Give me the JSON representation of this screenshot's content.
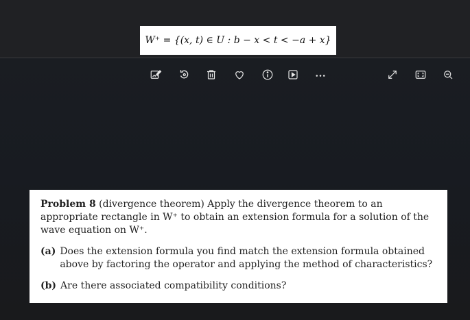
{
  "formula_card": {
    "text": "W⁺ = {(x, t) ∈ U : b − x < t < −a + x}"
  },
  "toolbar": {
    "buttons": [
      {
        "name": "edit-image-icon"
      },
      {
        "name": "rotate-icon"
      },
      {
        "name": "trash-icon"
      },
      {
        "name": "heart-icon"
      },
      {
        "name": "info-icon"
      },
      {
        "name": "slideshow-icon"
      },
      {
        "name": "more-icon"
      },
      {
        "name": "expand-icon"
      },
      {
        "name": "fullscreen-icon"
      },
      {
        "name": "zoom-out-icon"
      }
    ]
  },
  "problem": {
    "label": "Problem 8",
    "text": "(divergence theorem) Apply the divergence theorem to an appropriate rectangle in W⁺ to obtain an extension formula for a solution of the wave equation on W⁺.",
    "items": [
      {
        "label": "(a)",
        "text": "Does the extension formula you find match the extension formula obtained above by factoring the operator and applying the method of characteristics?"
      },
      {
        "label": "(b)",
        "text": "Are there associated compatibility conditions?"
      }
    ]
  }
}
